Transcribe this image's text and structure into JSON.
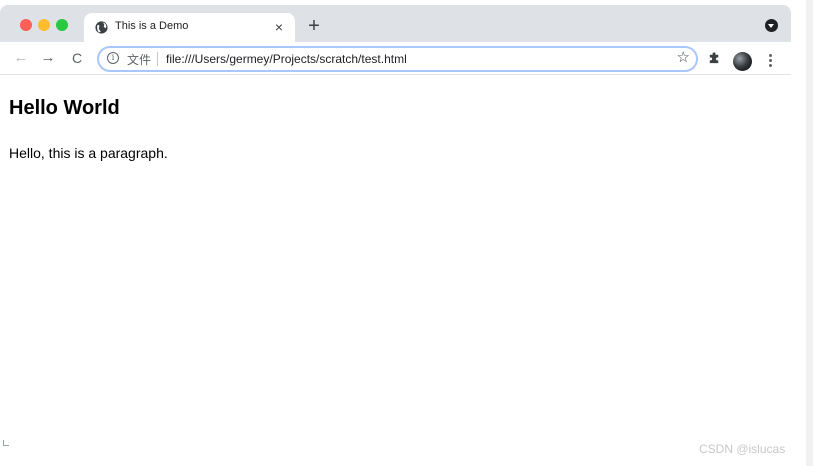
{
  "window": {
    "traffic_lights": [
      "close",
      "minimize",
      "maximize"
    ]
  },
  "tab": {
    "title": "This is a Demo",
    "close_symbol": "×",
    "icon": "globe-icon"
  },
  "new_tab_symbol": "+",
  "toolbar": {
    "back_symbol": "←",
    "forward_symbol": "→",
    "reload_symbol": "C",
    "omnibox": {
      "info_symbol": "i",
      "label": "文件",
      "url": "file:///Users/germey/Projects/scratch/test.html",
      "star_symbol": "☆"
    },
    "extensions_icon": "puzzle-icon",
    "avatar_icon": "profile-avatar",
    "menu_icon": "kebab-menu-icon"
  },
  "page": {
    "heading": "Hello World",
    "paragraph": "Hello, this is a paragraph."
  },
  "watermark": "CSDN @islucas",
  "colors": {
    "close": "#ff5f57",
    "minimize": "#febc2e",
    "maximize": "#28c840",
    "omnibox_focus": "#a8c7fa",
    "tabstrip": "#dee1e6"
  }
}
